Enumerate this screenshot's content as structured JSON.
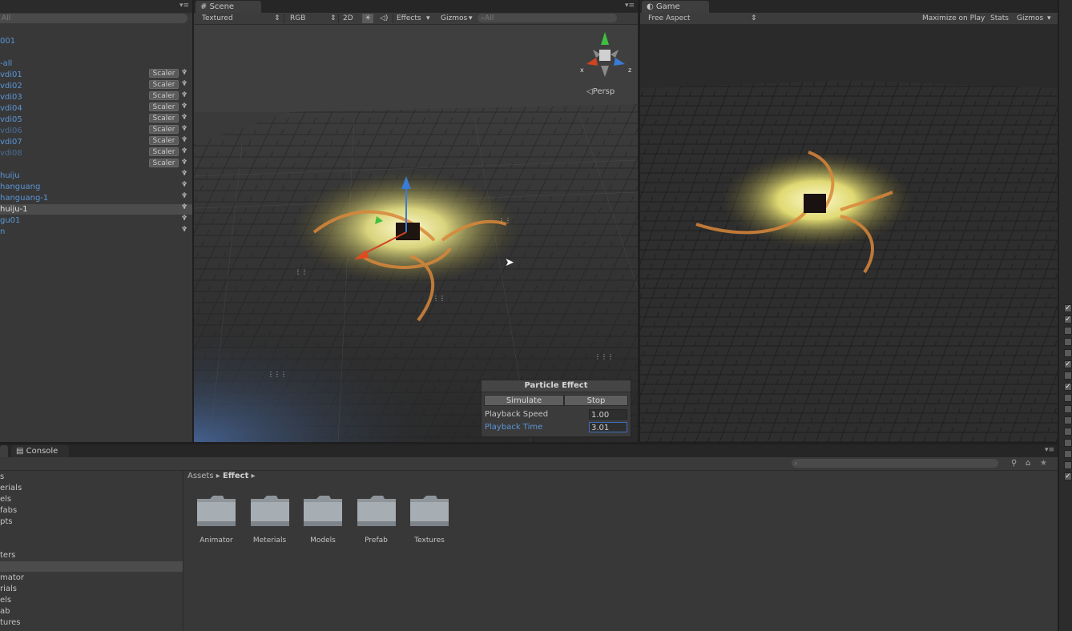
{
  "hierarchy": {
    "search_placeholder": "All",
    "items": [
      {
        "label": "001",
        "style": "normal"
      },
      {
        "label": "-all",
        "style": "normal"
      },
      {
        "label": "vdi01",
        "style": "normal"
      },
      {
        "label": "vdi02",
        "style": "normal"
      },
      {
        "label": "vdi03",
        "style": "normal"
      },
      {
        "label": "vdi04",
        "style": "normal"
      },
      {
        "label": "vdi05",
        "style": "normal"
      },
      {
        "label": "vdi06",
        "style": "dim"
      },
      {
        "label": "vdi07",
        "style": "normal"
      },
      {
        "label": "vdi08",
        "style": "dim"
      },
      {
        "label": "huiju",
        "style": "normal"
      },
      {
        "label": "hanguang",
        "style": "normal"
      },
      {
        "label": "hanguang-1",
        "style": "normal"
      },
      {
        "label": "huiju-1",
        "style": "selected"
      },
      {
        "label": "gu01",
        "style": "normal"
      },
      {
        "label": "n",
        "style": "normal"
      }
    ],
    "scaler_label": "Scaler"
  },
  "scene": {
    "tab_label": "Scene",
    "shading": "Textured",
    "render_mode": "RGB",
    "mode_2d": "2D",
    "effects": "Effects",
    "gizmos": "Gizmos",
    "search_placeholder": "All",
    "persp_label": "Persp",
    "axis_x": "x",
    "axis_z": "z"
  },
  "particle_effect": {
    "title": "Particle Effect",
    "simulate": "Simulate",
    "stop": "Stop",
    "playback_speed_label": "Playback Speed",
    "playback_speed_value": "1.00",
    "playback_time_label": "Playback Time",
    "playback_time_value": "3.01"
  },
  "game": {
    "tab_label": "Game",
    "aspect": "Free Aspect",
    "maximize": "Maximize on Play",
    "stats": "Stats",
    "gizmos": "Gizmos"
  },
  "bottom": {
    "console_tab": "Console",
    "tree_items": [
      "s",
      "erials",
      "els",
      "fabs",
      "pts",
      "ters",
      "",
      "mator",
      "rials",
      "els",
      "ab",
      "tures"
    ],
    "breadcrumb_root": "Assets",
    "breadcrumb_current": "Effect",
    "folders": [
      "Animator",
      "Meterials",
      "Models",
      "Prefab",
      "Textures"
    ]
  },
  "colors": {
    "link_blue": "#5b95d6",
    "glow_yellow": "#f6f08a",
    "selection_blue": "#3d6fbf"
  }
}
